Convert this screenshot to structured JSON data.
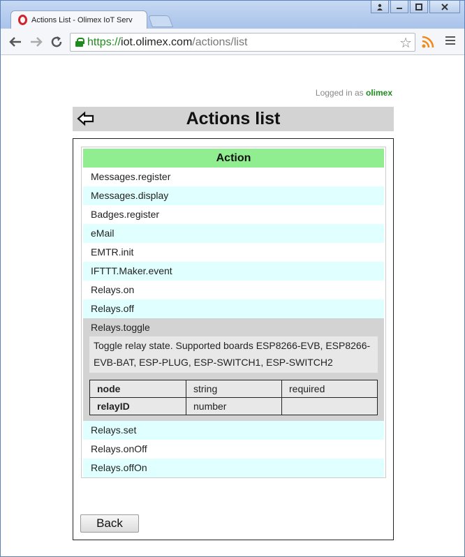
{
  "browser": {
    "tab_title": "Actions List - Olimex IoT Serv",
    "url_scheme": "https://",
    "url_host": "iot.olimex.com",
    "url_path": "/actions/list"
  },
  "header": {
    "logged_label": "Logged in as",
    "username": "olimex",
    "title": "Actions list"
  },
  "table": {
    "column_header": "Action",
    "rows_before": [
      {
        "name": "Messages.register",
        "alt": false
      },
      {
        "name": "Messages.display",
        "alt": true
      },
      {
        "name": "Badges.register",
        "alt": false
      },
      {
        "name": "eMail",
        "alt": true
      },
      {
        "name": "EMTR.init",
        "alt": false
      },
      {
        "name": "IFTTT.Maker.event",
        "alt": true
      },
      {
        "name": "Relays.on",
        "alt": false
      },
      {
        "name": "Relays.off",
        "alt": true
      }
    ],
    "expanded": {
      "name": "Relays.toggle",
      "description": "Toggle relay state. Supported boards ESP8266-EVB, ESP8266-EVB-BAT, ESP-PLUG, ESP-SWITCH1, ESP-SWITCH2",
      "params": [
        {
          "name": "node",
          "type": "string",
          "required": "required"
        },
        {
          "name": "relayID",
          "type": "number",
          "required": ""
        }
      ]
    },
    "rows_after": [
      {
        "name": "Relays.set",
        "alt": true
      },
      {
        "name": "Relays.onOff",
        "alt": false
      },
      {
        "name": "Relays.offOn",
        "alt": true
      }
    ]
  },
  "footer": {
    "back_label": "Back"
  },
  "colors": {
    "header_green": "#90ee90",
    "row_alt": "#e0ffff",
    "user_green": "#1d8c1d"
  },
  "icons": [
    "opera-logo-icon",
    "back-arrow-icon",
    "forward-arrow-icon",
    "reload-icon",
    "lock-icon",
    "star-icon",
    "rss-icon",
    "menu-icon",
    "back-page-arrow-icon"
  ]
}
